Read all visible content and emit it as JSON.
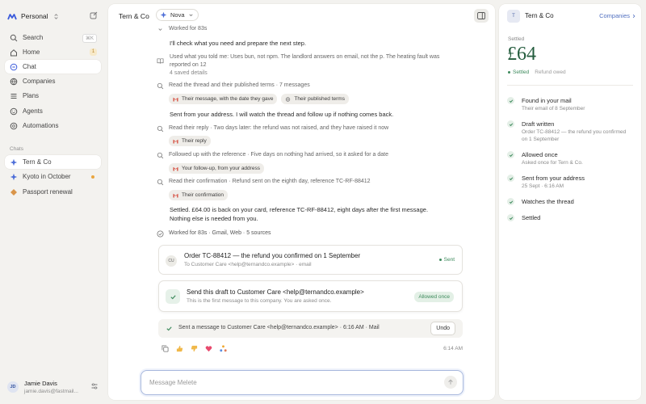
{
  "sidebar": {
    "workspace": "Personal",
    "nav": [
      {
        "label": "Search",
        "shortcut": "⌘K"
      },
      {
        "label": "Home",
        "badge": "1"
      },
      {
        "label": "Chat"
      },
      {
        "label": "Companies"
      },
      {
        "label": "Plans"
      },
      {
        "label": "Agents"
      },
      {
        "label": "Automations"
      }
    ],
    "chats_label": "Chats",
    "chats": [
      {
        "label": "Tern & Co"
      },
      {
        "label": "Kyoto in October"
      },
      {
        "label": "Passport renewal"
      }
    ],
    "user": {
      "initials": "JD",
      "name": "Jamie Davis",
      "email": "jamie.davis@fastmail..."
    }
  },
  "chat": {
    "title": "Tern & Co",
    "model": "Nova",
    "worked_top": "Worked for 83s",
    "intro": "I'll check what you need and prepare the next step.",
    "memory_line": "Used what you told me: Uses bun, not npm. The landlord answers on email, not the p. The heating fault was",
    "memory_line2": "reported on 12",
    "memory_saved": "4 saved details",
    "step1": "Read the thread and their published terms · 7 messages",
    "chip1a": "Their message, with the date they gave",
    "chip1b": "Their published terms",
    "sent_line": "Sent from your address. I will watch the thread and follow up if nothing comes back.",
    "step2": "Read their reply · Two days later: the refund was not raised, and they have raised it now",
    "chip2": "Their reply",
    "step3": "Followed up with the reference · Five days on nothing had arrived, so it asked for a date",
    "chip3": "Your follow-up, from your address",
    "step4": "Read their confirmation · Refund sent on the eighth day, reference TC-RF-88412",
    "chip4": "Their confirmation",
    "settled_line1": "Settled. £64.00 is back on your card, reference TC-RF-88412, eight days after the first message.",
    "settled_line2": "Nothing else is needed from you.",
    "worked_bottom": "Worked for 83s · Gmail, Web · 5 sources",
    "email_card": {
      "initials": "CU",
      "subject": "Order TC-88412 — the refund you confirmed on 1 September",
      "to": "To Customer Care <help@ternandco.example> · email",
      "status": "Sent"
    },
    "approval_card": {
      "title": "Send this draft to Customer Care <help@ternandco.example>",
      "subtitle": "This is the first message to this company. You are asked once.",
      "status": "Allowed once"
    },
    "action_row": {
      "text": "Sent a message to Customer Care <help@ternandco.example> · 6:16 AM · Mail",
      "undo": "Undo"
    },
    "time": "6:14 AM",
    "input_placeholder": "Message Melete"
  },
  "panel": {
    "initial": "T",
    "name": "Tern & Co",
    "link": "Companies",
    "status_label": "Settled",
    "amount": "£64",
    "tag_settled": "Settled",
    "tag_owed": "Refund owed",
    "timeline": [
      {
        "title": "Found in your mail",
        "sub": [
          "Their email of 8 September"
        ]
      },
      {
        "title": "Draft written",
        "sub": [
          "Order TC-88412 — the refund you confirmed",
          "on 1 September"
        ]
      },
      {
        "title": "Allowed once",
        "sub": [
          "Asked once for Tern & Co."
        ]
      },
      {
        "title": "Sent from your address",
        "sub": [
          "25 Sept · 6:16 AM"
        ]
      },
      {
        "title": "Watches the thread",
        "sub": []
      },
      {
        "title": "Settled",
        "sub": []
      }
    ]
  },
  "colors": {
    "accent": "#3b5bdb",
    "success": "#3d8a5c",
    "amount": "#245c3d",
    "link": "#5170c0"
  }
}
